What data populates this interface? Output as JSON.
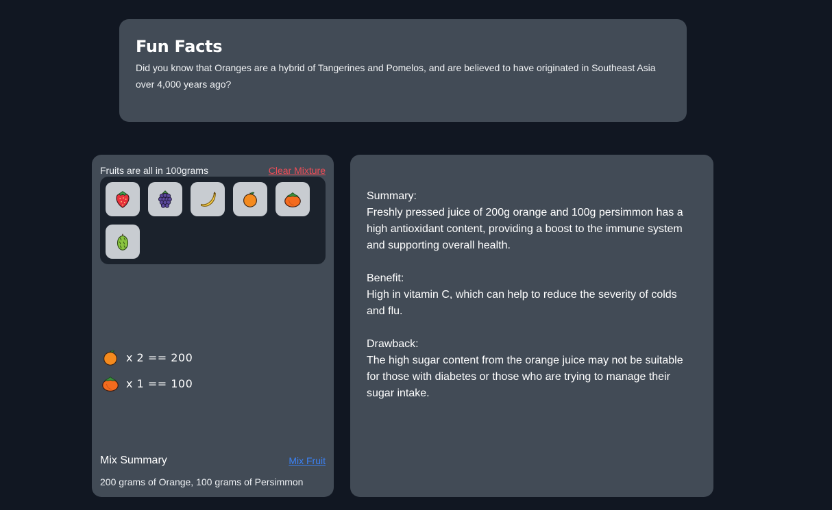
{
  "fun_facts": {
    "title": "Fun Facts",
    "text": "Did you know that Oranges are a hybrid of Tangerines and Pomelos, and are believed to have originated in Southeast Asia over 4,000 years ago?"
  },
  "mixer": {
    "note": "Fruits are all in 100grams",
    "clear_label": "Clear Mixture",
    "fruits": [
      {
        "icon": "strawberry-icon"
      },
      {
        "icon": "blackberry-icon"
      },
      {
        "icon": "banana-icon"
      },
      {
        "icon": "orange-icon"
      },
      {
        "icon": "persimmon-icon"
      },
      {
        "icon": "durian-icon"
      }
    ],
    "selection": [
      {
        "icon": "orange-icon",
        "text": "x 2 == 200"
      },
      {
        "icon": "persimmon-icon",
        "text": "x 1 == 100"
      }
    ],
    "summary_title": "Mix Summary",
    "mix_label": "Mix Fruit",
    "summary_text": "200 grams of Orange, 100 grams of Persimmon"
  },
  "result": {
    "summary_heading": "Summary:",
    "summary_text": "Freshly pressed juice of 200g orange and 100g persimmon has a high antioxidant content, providing a boost to the immune system and supporting overall health.",
    "benefit_heading": "Benefit:",
    "benefit_text": "High in vitamin C, which can help to reduce the severity of colds and flu.",
    "drawback_heading": "Drawback:",
    "drawback_text": "The high sugar content from the orange juice may not be suitable for those with diabetes or those who are trying to manage their sugar intake."
  },
  "colors": {
    "background": "#111722",
    "card": "#424b56",
    "tray": "#1b222c",
    "clear_link": "#ef4d57",
    "mix_link": "#3b82f6"
  }
}
